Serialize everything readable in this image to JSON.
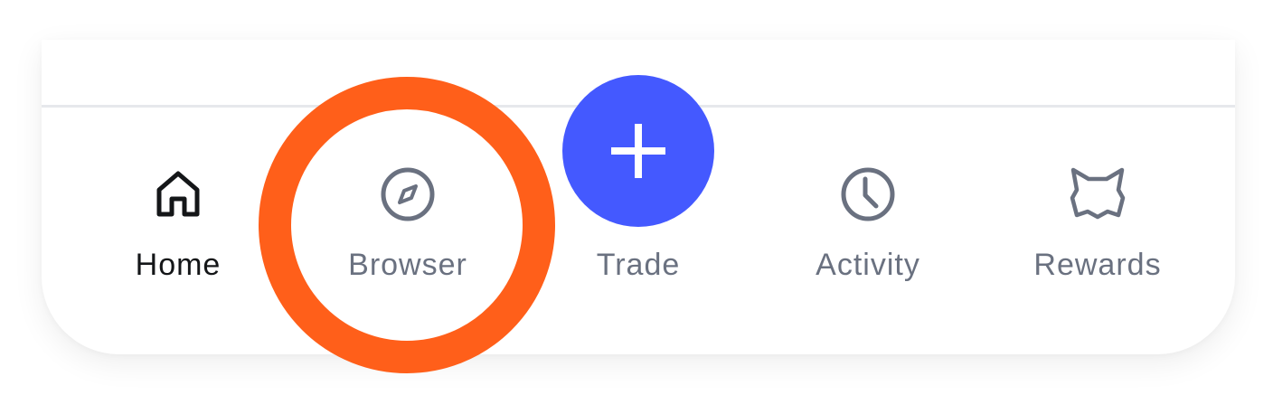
{
  "nav": {
    "items": [
      {
        "label": "Home",
        "icon": "home-icon",
        "active": true
      },
      {
        "label": "Browser",
        "icon": "compass-icon",
        "active": false
      },
      {
        "label": "Trade",
        "icon": "plus-icon",
        "active": false
      },
      {
        "label": "Activity",
        "icon": "clock-icon",
        "active": false
      },
      {
        "label": "Rewards",
        "icon": "fox-icon",
        "active": false
      }
    ]
  },
  "colors": {
    "active_text": "#141618",
    "inactive": "#6a7180",
    "fab": "#4459ff",
    "highlight": "#ff5f1a",
    "divider": "#e6e8ec"
  }
}
